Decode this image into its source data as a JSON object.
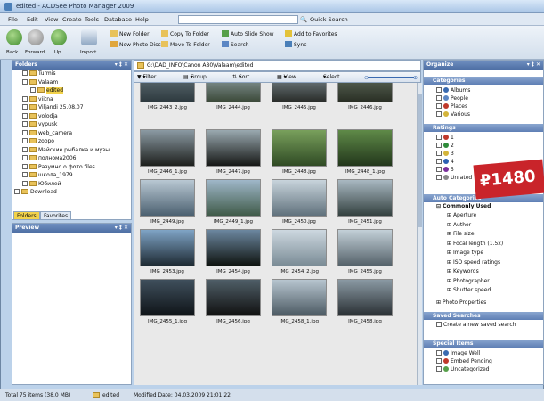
{
  "window": {
    "title": "edited - ACDSee Photo Manager 2009"
  },
  "menu": [
    "File",
    "Edit",
    "View",
    "Create",
    "Tools",
    "Database",
    "Help"
  ],
  "quick_search": {
    "label": "Quick Search",
    "value": ""
  },
  "toolbar": {
    "back": "Back",
    "forward": "Forward",
    "up": "Up",
    "import": "Import",
    "new_folder": "New Folder",
    "new_photo_disc": "New Photo Disc",
    "copy_to_folder": "Copy To Folder",
    "move_to_folder": "Move To Folder",
    "auto_slide_show": "Auto Slide Show",
    "search": "Search",
    "add_to_favorites": "Add to Favorites",
    "sync": "Sync"
  },
  "folders": {
    "title": "Folders",
    "items": [
      {
        "label": "Turmis",
        "indent": 1
      },
      {
        "label": "Valaam",
        "indent": 1
      },
      {
        "label": "edited",
        "indent": 2,
        "selected": true
      },
      {
        "label": "viitna",
        "indent": 1
      },
      {
        "label": "Viljandi 25.08.07",
        "indent": 1
      },
      {
        "label": "volodja",
        "indent": 1
      },
      {
        "label": "vypusk",
        "indent": 1
      },
      {
        "label": "web_camera",
        "indent": 1
      },
      {
        "label": "zoopo",
        "indent": 1
      },
      {
        "label": "Майские рыбалка и музы",
        "indent": 1
      },
      {
        "label": "полнома2006",
        "indent": 1
      },
      {
        "label": "Разумно о фото.files",
        "indent": 1
      },
      {
        "label": "школа_1979",
        "indent": 1
      },
      {
        "label": "Юбилей",
        "indent": 1
      },
      {
        "label": "Download",
        "indent": 0
      }
    ],
    "tabs": [
      "Folders",
      "Favorites"
    ]
  },
  "preview": {
    "title": "Preview"
  },
  "path": "G:\\DAD_INFO\\Canon A80\\Valaam\\edited",
  "filterbar": {
    "filter": "Filter By",
    "group": "Group By",
    "sort": "Sort By",
    "view": "View",
    "select": "Select"
  },
  "thumbnails": [
    {
      "name": "IMG_2443_2.jpg",
      "c1": "#6e7d84",
      "c2": "#2e3a3f"
    },
    {
      "name": "IMG_2444.jpg",
      "c1": "#a5b6bf",
      "c2": "#3c4a3a"
    },
    {
      "name": "IMG_2445.jpg",
      "c1": "#8fa0a8",
      "c2": "#2a2d2a"
    },
    {
      "name": "IMG_2446.jpg",
      "c1": "#6d7c6a",
      "c2": "#2a2f25"
    },
    {
      "name": "IMG_2446_1.jpg",
      "c1": "#8b9aa3",
      "c2": "#1d1f1c"
    },
    {
      "name": "IMG_2447.jpg",
      "c1": "#9aa9b0",
      "c2": "#151715"
    },
    {
      "name": "IMG_2448.jpg",
      "c1": "#79a05c",
      "c2": "#2f4a24"
    },
    {
      "name": "IMG_2448_1.jpg",
      "c1": "#5f8a48",
      "c2": "#22361b"
    },
    {
      "name": "IMG_2449.jpg",
      "c1": "#b9c8d3",
      "c2": "#4b6070"
    },
    {
      "name": "IMG_2449_1.jpg",
      "c1": "#9fb7c9",
      "c2": "#3f5a48"
    },
    {
      "name": "IMG_2450.jpg",
      "c1": "#c8d4dc",
      "c2": "#60717c"
    },
    {
      "name": "IMG_2451.jpg",
      "c1": "#a9b8c2",
      "c2": "#33403f"
    },
    {
      "name": "IMG_2453.jpg",
      "c1": "#7fa4c6",
      "c2": "#1e2a33"
    },
    {
      "name": "IMG_2454.jpg",
      "c1": "#6c87a0",
      "c2": "#0f1410"
    },
    {
      "name": "IMG_2454_2.jpg",
      "c1": "#cdd8e0",
      "c2": "#7b8c96"
    },
    {
      "name": "IMG_2455.jpg",
      "c1": "#c3d0d8",
      "c2": "#55626a"
    },
    {
      "name": "IMG_2455_1.jpg",
      "c1": "#3f4f5c",
      "c2": "#0f1418"
    },
    {
      "name": "IMG_2456.jpg",
      "c1": "#4f5e67",
      "c2": "#111"
    },
    {
      "name": "IMG_2458_1.jpg",
      "c1": "#b7c5cf",
      "c2": "#4c5a63"
    },
    {
      "name": "IMG_2458.jpg",
      "c1": "#8a99a3",
      "c2": "#2a3034"
    }
  ],
  "organize": {
    "title": "Organize",
    "categories_title": "Categories",
    "categories": [
      "Albums",
      "People",
      "Places",
      "Various"
    ],
    "ratings_title": "Ratings",
    "ratings": [
      {
        "label": "1",
        "color": "#c0392b"
      },
      {
        "label": "2",
        "color": "#2e8b3a"
      },
      {
        "label": "3",
        "color": "#d4b43a"
      },
      {
        "label": "4",
        "color": "#2b5fb3"
      },
      {
        "label": "5",
        "color": "#7a2f9c"
      },
      {
        "label": "Unrated",
        "color": "#888888"
      }
    ],
    "auto_title": "Auto Categories",
    "auto_group": "Commonly Used",
    "auto_items": [
      "Aperture",
      "Author",
      "File size",
      "Focal length (1.5x)",
      "Image type",
      "ISO speed ratings",
      "Keywords",
      "Photographer",
      "Shutter speed"
    ],
    "auto_extra": "Photo Properties",
    "saved_title": "Saved Searches",
    "saved_create": "Create a new saved search",
    "special_title": "Special Items",
    "special": [
      "Image Well",
      "Embed Pending",
      "Uncategorized"
    ]
  },
  "price": "₽1480",
  "status": {
    "total": "Total 75 items  (38.0 MB)",
    "folder": "edited",
    "modified": "Modified Date: 04.03.2009 21:01:22"
  }
}
